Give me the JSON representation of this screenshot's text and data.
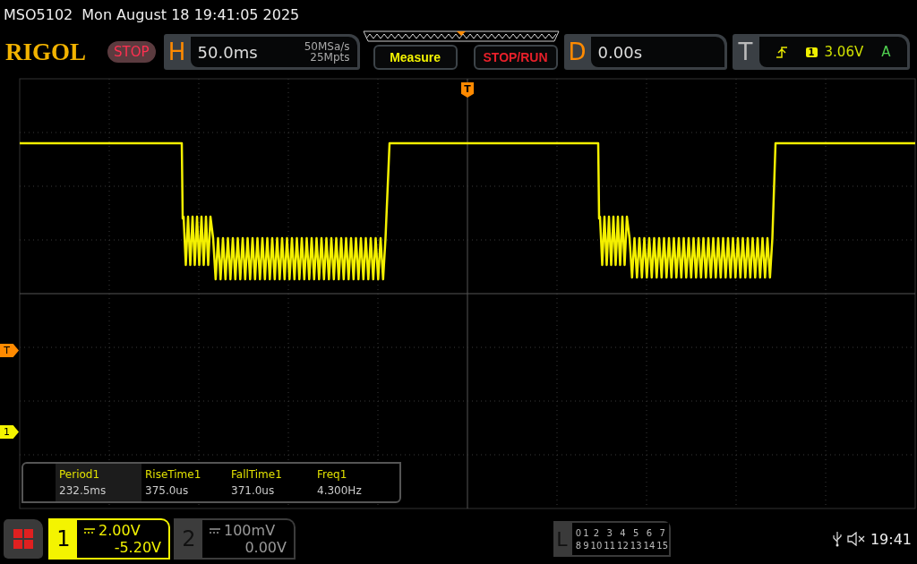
{
  "title_bar": {
    "model": "MSO5102",
    "datetime": "Mon August 18 19:41:05 2025"
  },
  "header": {
    "logo": "RIGOL",
    "run_state": "STOP",
    "horizontal": {
      "label": "H",
      "timebase": "50.0ms",
      "sample_rate": "50MSa/s",
      "memory_depth": "25Mpts"
    },
    "buttons": [
      {
        "label": "Measure",
        "kind": "menu"
      },
      {
        "label": "STOP/RUN",
        "kind": "run"
      }
    ],
    "delay": {
      "label": "D",
      "value": "0.00s"
    },
    "trigger": {
      "label": "T",
      "source": "1",
      "level": "3.06V",
      "mode": "A"
    }
  },
  "markers": {
    "trigger_position": "T",
    "trigger_level": "T",
    "channel": "1"
  },
  "measurements": [
    {
      "name": "Period1",
      "value": "232.5ms",
      "selected": true
    },
    {
      "name": "RiseTime1",
      "value": "375.0us",
      "selected": false
    },
    {
      "name": "FallTime1",
      "value": "371.0us",
      "selected": false
    },
    {
      "name": "Freq1",
      "value": "4.300Hz",
      "selected": false
    }
  ],
  "channels": [
    {
      "number": "1",
      "scale": "2.00V",
      "offset": "-5.20V",
      "on": true
    },
    {
      "number": "2",
      "scale": "100mV",
      "offset": "0.00V",
      "on": false
    }
  ],
  "logic": {
    "label": "L",
    "rows": [
      [
        "0",
        "1",
        "2",
        "3",
        "4",
        "5",
        "6",
        "7"
      ],
      [
        "8",
        "9",
        "10",
        "11",
        "12",
        "13",
        "14",
        "15"
      ]
    ]
  },
  "status": {
    "time": "19:41"
  }
}
